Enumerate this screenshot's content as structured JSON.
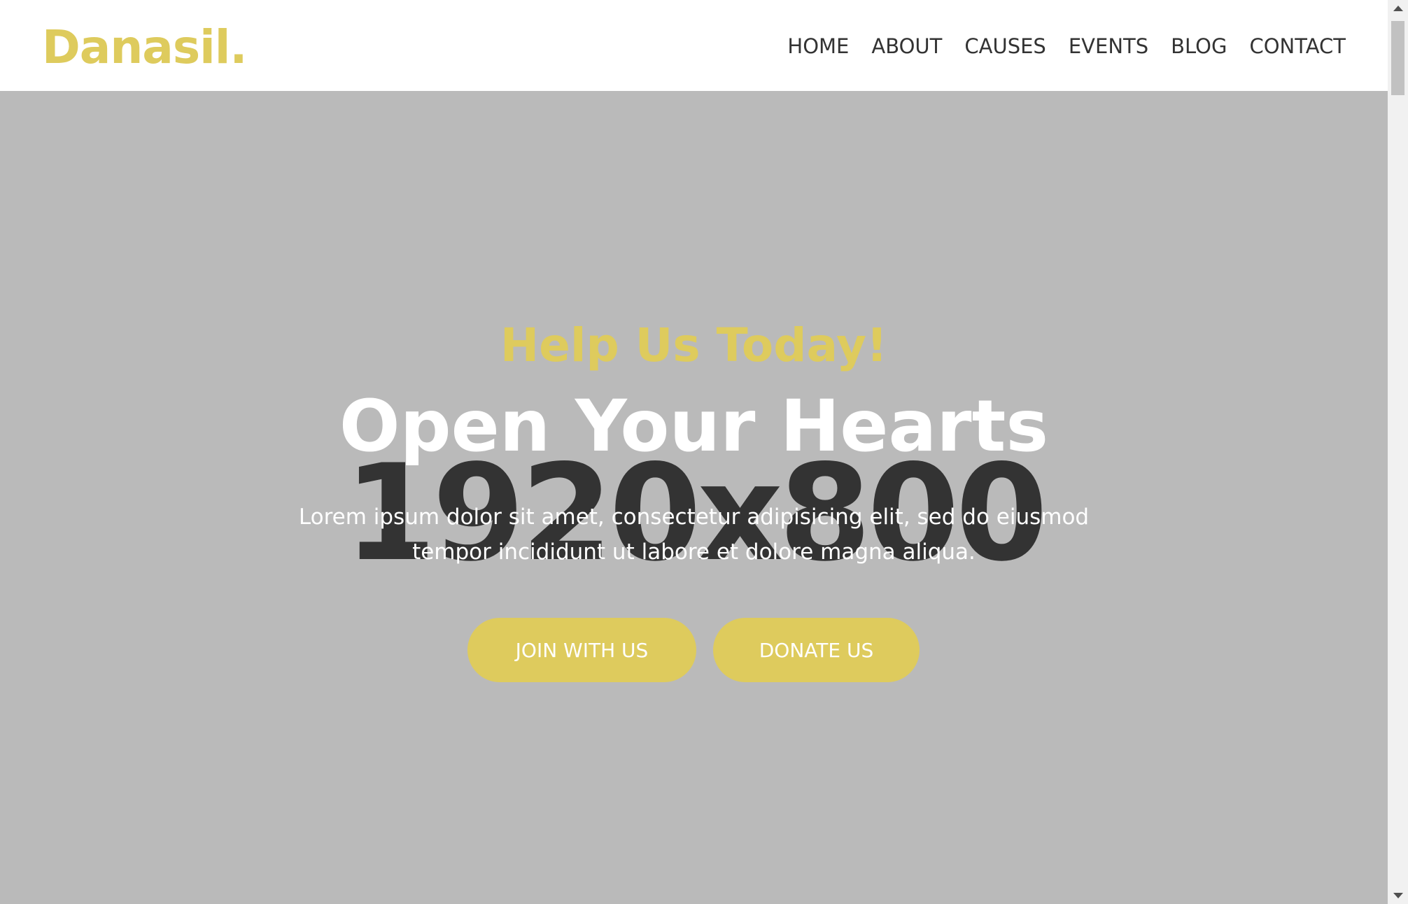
{
  "header": {
    "logo": "Danasil.",
    "nav": [
      {
        "label": "HOME",
        "active": true
      },
      {
        "label": "ABOUT",
        "active": false
      },
      {
        "label": "CAUSES",
        "active": false
      },
      {
        "label": "EVENTS",
        "active": false
      },
      {
        "label": "BLOG",
        "active": false
      },
      {
        "label": "CONTACT",
        "active": false
      }
    ]
  },
  "hero": {
    "placeholder": "1920x800",
    "subtitle": "Help Us Today!",
    "title": "Open Your Hearts",
    "description": "Lorem ipsum dolor sit amet, consectetur adipisicing elit, sed do eiusmod tempor incididunt ut labore et dolore magna aliqua.",
    "buttons": {
      "join": "JOIN WITH US",
      "donate": "DONATE US"
    }
  },
  "colors": {
    "accent": "#decb5d",
    "hero_background": "#bababa",
    "nav_text": "#333333",
    "placeholder_text": "#333333"
  }
}
